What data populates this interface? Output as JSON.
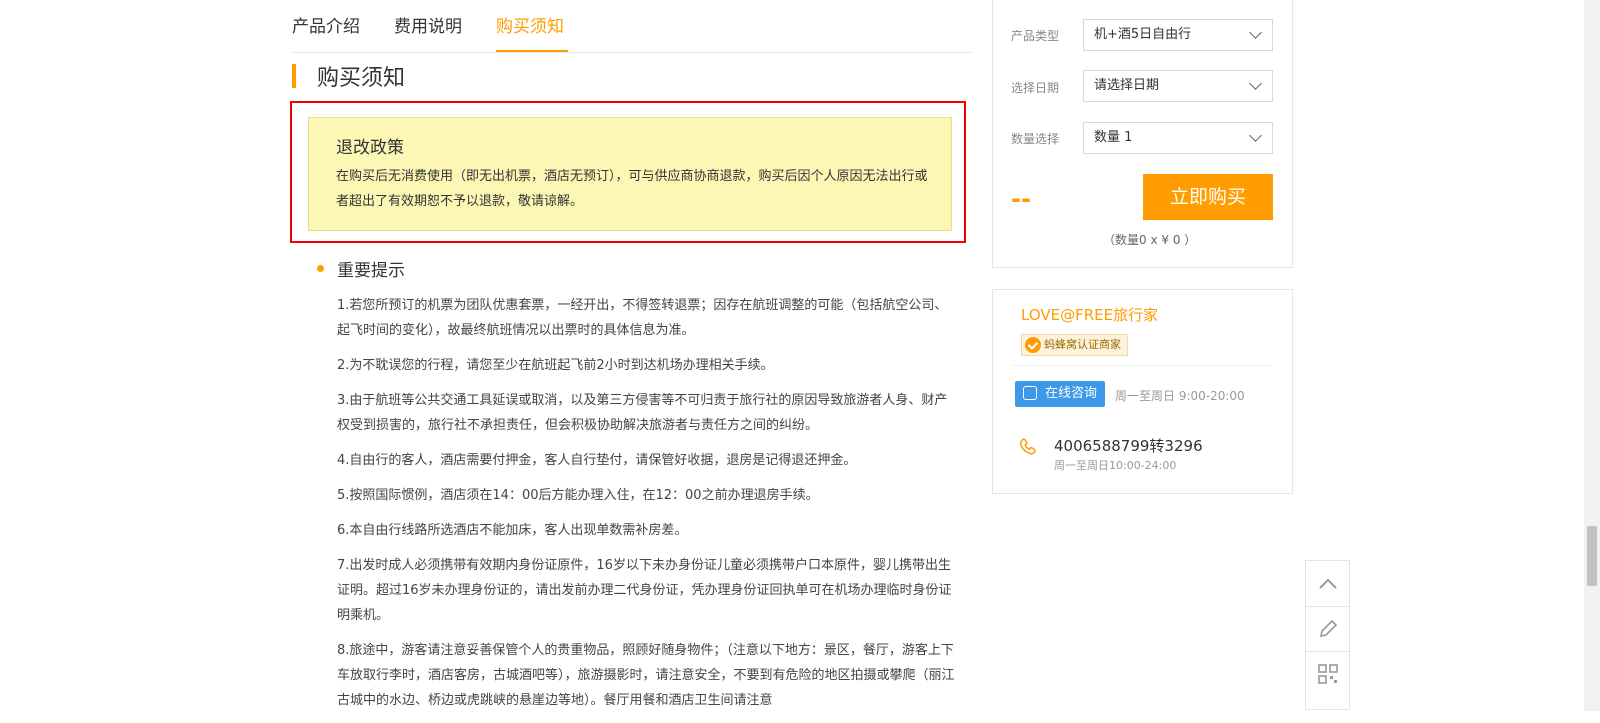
{
  "tabs": [
    {
      "label": "产品介绍",
      "active": false
    },
    {
      "label": "费用说明",
      "active": false
    },
    {
      "label": "购买须知",
      "active": true
    }
  ],
  "section_title": "购买须知",
  "policy": {
    "title": "退改政策",
    "body": "在购买后无消费使用（即无出机票，酒店无预订），可与供应商协商退款，购买后因个人原因无法出行或者超出了有效期恕不予以退款，敬请谅解。"
  },
  "tips": {
    "title": "重要提示",
    "items": [
      "1.若您所预订的机票为团队优惠套票，一经开出，不得签转退票；因存在航班调整的可能（包括航空公司、起飞时间的变化），故最终航班情况以出票时的具体信息为准。",
      "2.为不耽误您的行程，请您至少在航班起飞前2小时到达机场办理相关手续。",
      "3.由于航班等公共交通工具延误或取消，以及第三方侵害等不可归责于旅行社的原因导致旅游者人身、财产权受到损害的，旅行社不承担责任，但会积极协助解决旅游者与责任方之间的纠纷。",
      "4.自由行的客人，酒店需要付押金，客人自行垫付，请保管好收据，退房是记得退还押金。",
      "5.按照国际惯例，酒店须在14：00后方能办理入住，在12：00之前办理退房手续。",
      "6.本自由行线路所选酒店不能加床，客人出现单数需补房差。",
      "7.出发时成人必须携带有效期内身份证原件，16岁以下未办身份证儿童必须携带户口本原件，婴儿携带出生证明。超过16岁未办理身份证的，请出发前办理二代身份证，凭办理身份证回执单可在机场办理临时身份证明乘机。",
      "8.旅途中，游客请注意妥善保管个人的贵重物品，照顾好随身物件；（注意以下地方：景区，餐厅，游客上下车放取行李时，酒店客房，古城酒吧等），旅游摄影时，请注意安全，不要到有危险的地区拍摄或攀爬（丽江古城中的水边、桥边或虎跳峡的悬崖边等地）。餐厅用餐和酒店卫生间请注意"
    ]
  },
  "booking": {
    "type_label": "产品类型",
    "type_value": "机+酒5日自由行",
    "date_label": "选择日期",
    "date_placeholder": "请选择日期",
    "qty_label": "数量选择",
    "qty_value": "数量 1",
    "price": "--",
    "buy_label": "立即购买",
    "qty_note": "（数量0 x ¥ 0 ）"
  },
  "merchant": {
    "name": "LOVE@FREE旅行家",
    "badge": "蚂蜂窝认证商家",
    "consult_label": "在线咨询",
    "consult_hours": "周一至周日 9:00-20:00",
    "phone": "4006588799转3296",
    "phone_hours": "周一至周日10:00-24:00"
  },
  "colors": {
    "accent": "#ff9d00",
    "highlight_border": "#ee0000",
    "policy_bg": "#fdf7b6",
    "consult_blue": "#3d98e8"
  }
}
